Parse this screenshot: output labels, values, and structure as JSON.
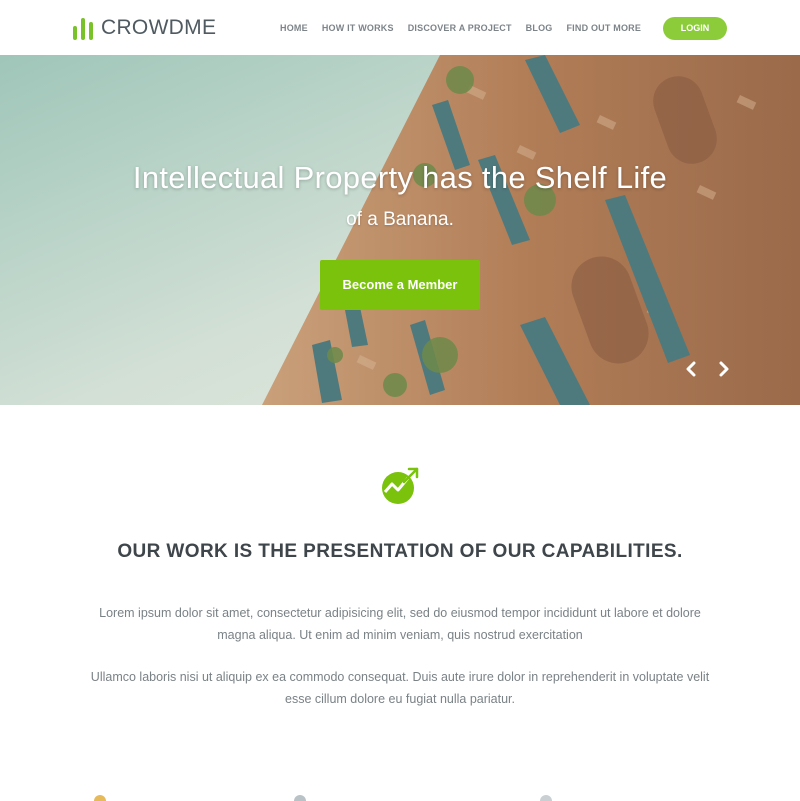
{
  "brand": {
    "name": "CROWDME",
    "accent_color": "#7ac20c"
  },
  "nav": {
    "items": [
      {
        "label": "HOME"
      },
      {
        "label": "HOW IT WORKS"
      },
      {
        "label": "DISCOVER A PROJECT"
      },
      {
        "label": "BLOG"
      },
      {
        "label": "FIND OUT MORE"
      }
    ],
    "login_label": "LOGIN"
  },
  "hero": {
    "title": "Intellectual Property has the Shelf Life",
    "subtitle": "of a Banana.",
    "cta_label": "Become a Member",
    "prev_icon": "chevron-left-icon",
    "next_icon": "chevron-right-icon"
  },
  "intro": {
    "icon": "growth-chart-icon",
    "title": "OUR WORK IS THE PRESENTATION OF OUR CAPABILITIES.",
    "paragraph_1": "Lorem ipsum dolor sit amet, consectetur adipisicing elit, sed do eiusmod tempor incididunt ut labore et dolore magna aliqua. Ut enim ad minim veniam, quis nostrud exercitation",
    "paragraph_2": "Ullamco laboris nisi ut aliquip ex ea commodo consequat. Duis aute irure dolor in reprehenderit in voluptate velit esse cillum dolore eu fugiat nulla pariatur."
  }
}
